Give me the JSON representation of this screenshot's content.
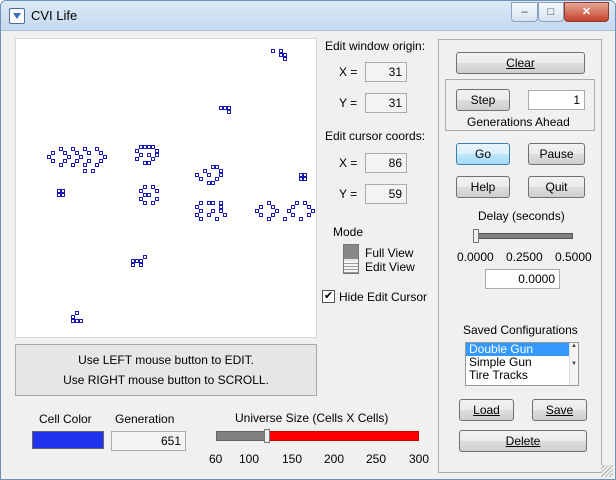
{
  "window": {
    "title": "CVI Life",
    "minimize": "–",
    "maximize": "□",
    "close": "✕"
  },
  "edit_origin": {
    "label": "Edit window origin:",
    "x_label": "X =",
    "x": "31",
    "y_label": "Y =",
    "y": "31"
  },
  "edit_cursor": {
    "label": "Edit cursor coords:",
    "x_label": "X =",
    "x": "86",
    "y_label": "Y =",
    "y": "59"
  },
  "mode": {
    "label": "Mode",
    "full_view": "Full View",
    "edit_view": "Edit View"
  },
  "hide_cursor": {
    "label": "Hide Edit Cursor",
    "checked": true
  },
  "instructions": {
    "line1": "Use LEFT mouse button to EDIT.",
    "line2": "Use RIGHT mouse button to SCROLL."
  },
  "cell_color": {
    "label": "Cell Color",
    "color": "#2233ee"
  },
  "generation": {
    "label": "Generation",
    "value": "651"
  },
  "universe": {
    "label": "Universe Size (Cells X Cells)",
    "ticks": [
      "60",
      "100",
      "150",
      "200",
      "250",
      "300"
    ],
    "value": 120,
    "min": 60,
    "max": 300,
    "fill_color": "#ff0000"
  },
  "buttons": {
    "clear": "Clear",
    "step": "Step",
    "go": "Go",
    "pause": "Pause",
    "help": "Help",
    "quit": "Quit",
    "load": "Load",
    "save": "Save",
    "delete": "Delete"
  },
  "generations_ahead": {
    "label": "Generations Ahead",
    "value": "1"
  },
  "delay": {
    "label": "Delay (seconds)",
    "ticks": [
      "0.0000",
      "0.2500",
      "0.5000"
    ],
    "value": "0.0000"
  },
  "saved_configs": {
    "label": "Saved Configurations",
    "items": [
      "Double Gun",
      "Simple Gun",
      "Tire Tracks"
    ],
    "selected": 0
  },
  "cells": [
    [
      255,
      10
    ],
    [
      263,
      10
    ],
    [
      263,
      14
    ],
    [
      267,
      14
    ],
    [
      267,
      18
    ],
    [
      203,
      67
    ],
    [
      207,
      67
    ],
    [
      211,
      67
    ],
    [
      211,
      71
    ],
    [
      43,
      108
    ],
    [
      55,
      108
    ],
    [
      67,
      108
    ],
    [
      79,
      108
    ],
    [
      35,
      112
    ],
    [
      47,
      112
    ],
    [
      59,
      112
    ],
    [
      71,
      112
    ],
    [
      83,
      112
    ],
    [
      31,
      116
    ],
    [
      51,
      116
    ],
    [
      63,
      116
    ],
    [
      87,
      116
    ],
    [
      35,
      120
    ],
    [
      47,
      120
    ],
    [
      59,
      120
    ],
    [
      71,
      120
    ],
    [
      83,
      120
    ],
    [
      43,
      124
    ],
    [
      55,
      124
    ],
    [
      67,
      124
    ],
    [
      79,
      124
    ],
    [
      67,
      130
    ],
    [
      75,
      130
    ],
    [
      123,
      106
    ],
    [
      127,
      106
    ],
    [
      131,
      106
    ],
    [
      135,
      106
    ],
    [
      119,
      110
    ],
    [
      139,
      110
    ],
    [
      123,
      114
    ],
    [
      131,
      114
    ],
    [
      139,
      114
    ],
    [
      119,
      118
    ],
    [
      135,
      118
    ],
    [
      127,
      122
    ],
    [
      131,
      122
    ],
    [
      41,
      150
    ],
    [
      45,
      150
    ],
    [
      41,
      154
    ],
    [
      45,
      154
    ],
    [
      127,
      146
    ],
    [
      135,
      146
    ],
    [
      123,
      150
    ],
    [
      139,
      150
    ],
    [
      127,
      154
    ],
    [
      131,
      154
    ],
    [
      123,
      158
    ],
    [
      139,
      158
    ],
    [
      127,
      162
    ],
    [
      135,
      162
    ],
    [
      195,
      126
    ],
    [
      199,
      126
    ],
    [
      187,
      130
    ],
    [
      203,
      130
    ],
    [
      179,
      134
    ],
    [
      191,
      134
    ],
    [
      203,
      134
    ],
    [
      183,
      138
    ],
    [
      199,
      138
    ],
    [
      191,
      142
    ],
    [
      195,
      142
    ],
    [
      283,
      134
    ],
    [
      287,
      134
    ],
    [
      283,
      138
    ],
    [
      287,
      138
    ],
    [
      183,
      162
    ],
    [
      191,
      162
    ],
    [
      195,
      162
    ],
    [
      203,
      162
    ],
    [
      179,
      166
    ],
    [
      203,
      166
    ],
    [
      183,
      170
    ],
    [
      195,
      170
    ],
    [
      203,
      170
    ],
    [
      179,
      174
    ],
    [
      191,
      174
    ],
    [
      207,
      174
    ],
    [
      183,
      178
    ],
    [
      199,
      178
    ],
    [
      251,
      162
    ],
    [
      279,
      162
    ],
    [
      287,
      162
    ],
    [
      243,
      166
    ],
    [
      255,
      166
    ],
    [
      275,
      166
    ],
    [
      291,
      166
    ],
    [
      239,
      170
    ],
    [
      259,
      170
    ],
    [
      271,
      170
    ],
    [
      295,
      170
    ],
    [
      243,
      174
    ],
    [
      255,
      174
    ],
    [
      275,
      174
    ],
    [
      291,
      174
    ],
    [
      251,
      178
    ],
    [
      267,
      178
    ],
    [
      283,
      178
    ],
    [
      127,
      216
    ],
    [
      115,
      220
    ],
    [
      119,
      220
    ],
    [
      123,
      220
    ],
    [
      115,
      224
    ],
    [
      123,
      224
    ],
    [
      59,
      272
    ],
    [
      55,
      276
    ],
    [
      55,
      280
    ],
    [
      59,
      280
    ],
    [
      63,
      280
    ]
  ]
}
